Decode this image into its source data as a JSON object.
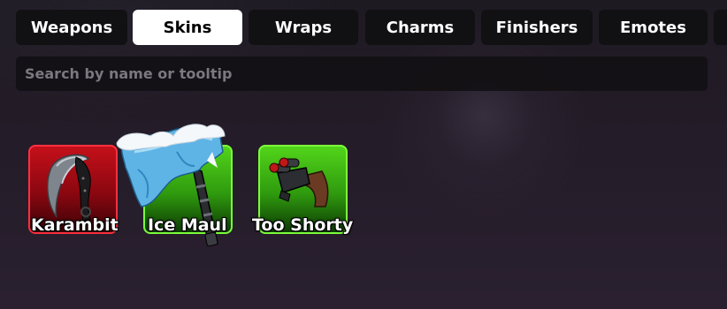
{
  "tabs": {
    "weapons": "Weapons",
    "skins": "Skins",
    "wraps": "Wraps",
    "charms": "Charms",
    "finishers": "Finishers",
    "emotes": "Emotes",
    "active": "Skins"
  },
  "search": {
    "placeholder": "Search by name or tooltip",
    "value": ""
  },
  "items": [
    {
      "name": "Karambit",
      "rarity_color": "#c5101a",
      "icon": "karambit-knife-icon"
    },
    {
      "name": "Ice Maul",
      "rarity_color": "#52d41a",
      "icon": "ice-maul-icon"
    },
    {
      "name": "Too Shorty",
      "rarity_color": "#52d41a",
      "icon": "too-shorty-shotgun-icon"
    }
  ]
}
